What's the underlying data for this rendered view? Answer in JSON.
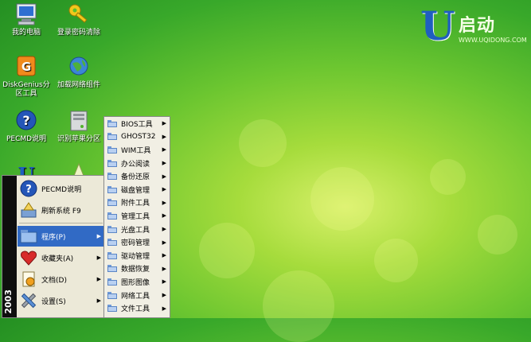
{
  "desktop": {
    "icons": [
      {
        "label": "我的电脑"
      },
      {
        "label": "登录密码清除"
      },
      {
        "label": "DiskGenius分区工具"
      },
      {
        "label": "加载网络组件"
      },
      {
        "label": "PECMD说明"
      },
      {
        "label": "识别苹果分区"
      }
    ]
  },
  "logo": {
    "mark": "U",
    "title": "启动",
    "subtitle": "WWW.UQIDONG.COM"
  },
  "start_menu": {
    "sidebar_text": "2003",
    "items": [
      {
        "label": "PECMD说明"
      },
      {
        "label": "刷新系统 F9"
      },
      {
        "label": "程序(P)",
        "submenu": true
      },
      {
        "label": "收藏夹(A)",
        "submenu": true
      },
      {
        "label": "文档(D)",
        "submenu": true
      },
      {
        "label": "设置(S)",
        "submenu": true
      }
    ]
  },
  "programs_menu": {
    "items": [
      {
        "label": "BIOS工具"
      },
      {
        "label": "GHOST32"
      },
      {
        "label": "WIM工具"
      },
      {
        "label": "办公阅读"
      },
      {
        "label": "备份还原"
      },
      {
        "label": "磁盘管理"
      },
      {
        "label": "附件工具"
      },
      {
        "label": "管理工具"
      },
      {
        "label": "光盘工具"
      },
      {
        "label": "密码管理"
      },
      {
        "label": "驱动管理"
      },
      {
        "label": "数据恢复"
      },
      {
        "label": "图形图像"
      },
      {
        "label": "网络工具"
      },
      {
        "label": "文件工具"
      }
    ]
  },
  "colors": {
    "selection": "#316ac5",
    "desktop_green": "#5cbf2e"
  }
}
